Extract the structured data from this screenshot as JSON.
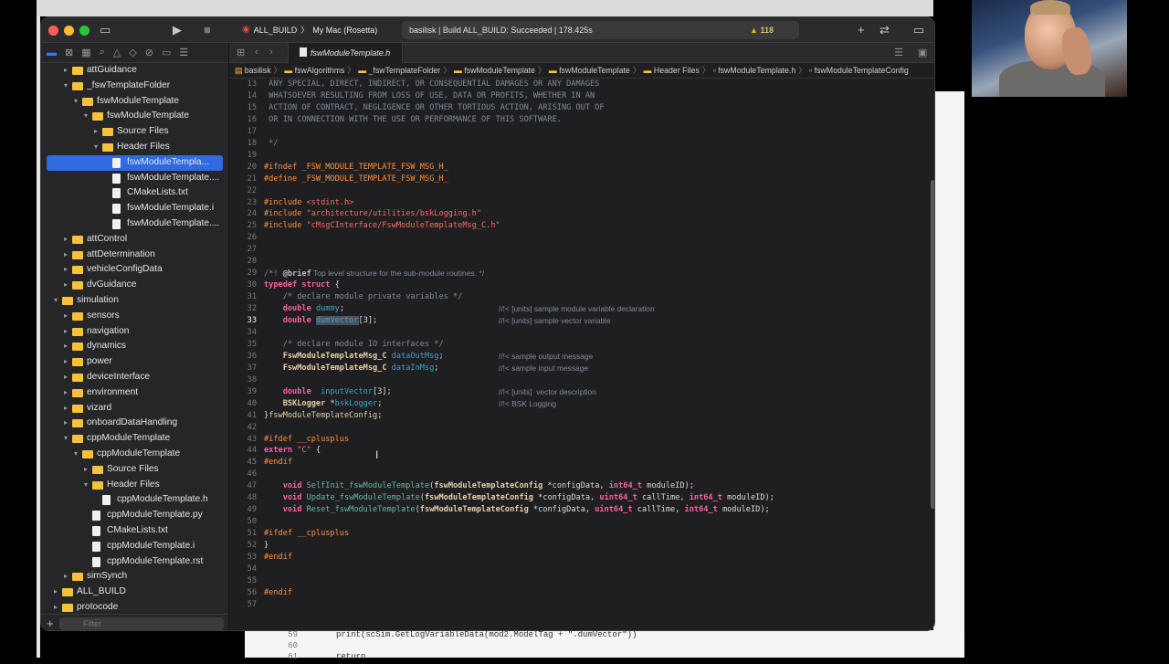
{
  "toolbar": {
    "scheme_target": "ALL_BUILD",
    "scheme_sep": "〉",
    "destination": "My Mac (Rosetta)",
    "status": "basilisk | Build ALL_BUILD: Succeeded | 178.425s",
    "warning_count": "118"
  },
  "tab": {
    "label": "fswModuleTemplate.h"
  },
  "breadcrumb": [
    "basilisk",
    "fswAlgorithms",
    "_fswTemplateFolder",
    "fswModuleTemplate",
    "fswModuleTemplate",
    "Header Files",
    "fswModuleTemplate.h",
    "fswModuleTemplateConfig"
  ],
  "sidebar": {
    "filter_placeholder": "Filter",
    "items": [
      {
        "label": "attGuidance",
        "type": "folder",
        "chev": "▸"
      },
      {
        "label": "_fswTemplateFolder",
        "type": "folder",
        "chev": "▾"
      },
      {
        "label": "fswModuleTemplate",
        "type": "folder",
        "chev": "▾"
      },
      {
        "label": "fswModuleTemplate",
        "type": "folder",
        "chev": "▾"
      },
      {
        "label": "Source Files",
        "type": "folder",
        "chev": "▸"
      },
      {
        "label": "Header Files",
        "type": "folder",
        "chev": "▾"
      },
      {
        "label": "fswModuleTempla...",
        "type": "file",
        "chev": ""
      },
      {
        "label": "fswModuleTemplate....",
        "type": "file",
        "chev": ""
      },
      {
        "label": "CMakeLists.txt",
        "type": "file",
        "chev": ""
      },
      {
        "label": "fswModuleTemplate.i",
        "type": "file",
        "chev": ""
      },
      {
        "label": "fswModuleTemplate....",
        "type": "file",
        "chev": ""
      },
      {
        "label": "attControl",
        "type": "folder",
        "chev": "▸"
      },
      {
        "label": "attDetermination",
        "type": "folder",
        "chev": "▸"
      },
      {
        "label": "vehicleConfigData",
        "type": "folder",
        "chev": "▸"
      },
      {
        "label": "dvGuidance",
        "type": "folder",
        "chev": "▸"
      },
      {
        "label": "simulation",
        "type": "folder",
        "chev": "▾"
      },
      {
        "label": "sensors",
        "type": "folder",
        "chev": "▸"
      },
      {
        "label": "navigation",
        "type": "folder",
        "chev": "▸"
      },
      {
        "label": "dynamics",
        "type": "folder",
        "chev": "▸"
      },
      {
        "label": "power",
        "type": "folder",
        "chev": "▸"
      },
      {
        "label": "deviceInterface",
        "type": "folder",
        "chev": "▸"
      },
      {
        "label": "environment",
        "type": "folder",
        "chev": "▸"
      },
      {
        "label": "vizard",
        "type": "folder",
        "chev": "▸"
      },
      {
        "label": "onboardDataHandling",
        "type": "folder",
        "chev": "▸"
      },
      {
        "label": "cppModuleTemplate",
        "type": "folder",
        "chev": "▾"
      },
      {
        "label": "cppModuleTemplate",
        "type": "folder",
        "chev": "▾"
      },
      {
        "label": "Source Files",
        "type": "folder",
        "chev": "▸"
      },
      {
        "label": "Header Files",
        "type": "folder",
        "chev": "▾"
      },
      {
        "label": "cppModuleTemplate.h",
        "type": "file",
        "chev": ""
      },
      {
        "label": "cppModuleTemplate.py",
        "type": "file",
        "chev": ""
      },
      {
        "label": "CMakeLists.txt",
        "type": "file",
        "chev": ""
      },
      {
        "label": "cppModuleTemplate.i",
        "type": "file",
        "chev": ""
      },
      {
        "label": "cppModuleTemplate.rst",
        "type": "file",
        "chev": ""
      },
      {
        "label": "simSynch",
        "type": "folder",
        "chev": "▸"
      },
      {
        "label": "ALL_BUILD",
        "type": "folder",
        "chev": "▸"
      },
      {
        "label": "protocode",
        "type": "folder",
        "chev": "▸"
      }
    ]
  },
  "code": {
    "current_line": 33,
    "lines": [
      {
        "n": "13",
        "html": "<span class=\"c-com\"> ANY SPECIAL, DIRECT, INDIRECT, OR CONSEQUENTIAL DAMAGES OR ANY DAMAGES</span>"
      },
      {
        "n": "14",
        "html": "<span class=\"c-com\"> WHATSOEVER RESULTING FROM LOSS OF USE, DATA OR PROFITS, WHETHER IN AN</span>"
      },
      {
        "n": "15",
        "html": "<span class=\"c-com\"> ACTION OF CONTRACT, NEGLIGENCE OR OTHER TORTIOUS ACTION, ARISING OUT OF</span>"
      },
      {
        "n": "16",
        "html": "<span class=\"c-com\"> OR IN CONNECTION WITH THE USE OR PERFORMANCE OF THIS SOFTWARE.</span>"
      },
      {
        "n": "17",
        "html": ""
      },
      {
        "n": "18",
        "html": "<span class=\"c-com\"> */</span>"
      },
      {
        "n": "19",
        "html": ""
      },
      {
        "n": "20",
        "html": "<span class=\"c-pp\">#ifndef _FSW_MODULE_TEMPLATE_FSW_MSG_H_</span>"
      },
      {
        "n": "21",
        "html": "<span class=\"c-pp\">#define _FSW_MODULE_TEMPLATE_FSW_MSG_H_</span>"
      },
      {
        "n": "22",
        "html": ""
      },
      {
        "n": "23",
        "html": "<span class=\"c-pp\">#include </span><span class=\"c-str\">&lt;stdint.h&gt;</span>"
      },
      {
        "n": "24",
        "html": "<span class=\"c-pp\">#include </span><span class=\"c-str\">\"architecture/utilities/bskLogging.h\"</span>"
      },
      {
        "n": "25",
        "html": "<span class=\"c-pp\">#include </span><span class=\"c-str\">\"cMsgCInterface/FswModuleTemplateMsg_C.h\"</span>"
      },
      {
        "n": "26",
        "html": ""
      },
      {
        "n": "27",
        "html": ""
      },
      {
        "n": "28",
        "html": ""
      },
      {
        "n": "29",
        "html": "<span class=\"c-com\">/*! </span><span style=\"color:#bdbdbd;font-weight:bold\">@brief</span><span class=\"c-com\" style=\"font-family:'Liberation Sans',sans-serif\"> Top level structure for the sub-module routines. */</span>"
      },
      {
        "n": "30",
        "html": "<span class=\"c-kw\">typedef struct</span> {"
      },
      {
        "n": "31",
        "html": "    <span class=\"c-com\">/* declare module private variables */</span>"
      },
      {
        "n": "32",
        "html": "    <span class=\"c-kw\">double</span> <span class=\"c-id\">dummy</span>;",
        "cm": "//!< [units] sample module variable declaration"
      },
      {
        "n": "33",
        "html": "    <span class=\"c-kw\">double</span> <span class=\"c-id hl\">dumVector</span>[3];",
        "cm": "//!< [units] sample vector variable"
      },
      {
        "n": "34",
        "html": ""
      },
      {
        "n": "35",
        "html": "    <span class=\"c-com\">/* declare module IO interfaces */</span>"
      },
      {
        "n": "36",
        "html": "    <span class=\"c-typ\" style=\"color:#e5cfa8;font-weight:bold\">FswModuleTemplateMsg_C</span> <span class=\"c-id\">dataOutMsg</span>;",
        "cm": "//!< sample output message"
      },
      {
        "n": "37",
        "html": "    <span class=\"c-typ\" style=\"color:#e5cfa8;font-weight:bold\">FswModuleTemplateMsg_C</span> <span class=\"c-id\">dataInMsg</span>;",
        "cm": "//!< sample input message"
      },
      {
        "n": "38",
        "html": ""
      },
      {
        "n": "39",
        "html": "    <span class=\"c-kw\">double</span>  <span class=\"c-id\">inputVector</span>[3];",
        "cm": "//!< [units]  vector description"
      },
      {
        "n": "40",
        "html": "    <span style=\"color:#e5cfa8;font-weight:bold\">BSKLogger</span> *<span class=\"c-id\">bskLogger</span>;",
        "cm": "//!< BSK Logging"
      },
      {
        "n": "41",
        "html": "}<span style=\"color:#e5cfa8\">fswModuleTemplateConfig</span>;"
      },
      {
        "n": "42",
        "html": ""
      },
      {
        "n": "43",
        "html": "<span class=\"c-pp\">#ifdef __cplusplus</span>"
      },
      {
        "n": "44",
        "html": "<span class=\"c-kw\">extern</span> <span class=\"c-str\">\"C\"</span> {"
      },
      {
        "n": "45",
        "html": "<span class=\"c-pp\">#endif</span>"
      },
      {
        "n": "46",
        "html": ""
      },
      {
        "n": "47",
        "html": "    <span class=\"c-kw\">void</span> <span class=\"c-fn\">SelfInit_fswModuleTemplate</span>(<span style=\"color:#e5cfa8;font-weight:bold\">fswModuleTemplateConfig</span> *configData, <span class=\"c-kw\">int64_t</span> moduleID);"
      },
      {
        "n": "48",
        "html": "    <span class=\"c-kw\">void</span> <span class=\"c-fn\">Update_fswModuleTemplate</span>(<span style=\"color:#e5cfa8;font-weight:bold\">fswModuleTemplateConfig</span> *configData, <span class=\"c-kw\">uint64_t</span> callTime, <span class=\"c-kw\">int64_t</span> moduleID);"
      },
      {
        "n": "49",
        "html": "    <span class=\"c-kw\">void</span> <span class=\"c-fn\">Reset_fswModuleTemplate</span>(<span style=\"color:#e5cfa8;font-weight:bold\">fswModuleTemplateConfig</span> *configData, <span class=\"c-kw\">uint64_t</span> callTime, <span class=\"c-kw\">int64_t</span> moduleID);"
      },
      {
        "n": "50",
        "html": ""
      },
      {
        "n": "51",
        "html": "<span class=\"c-pp\">#ifdef __cplusplus</span>"
      },
      {
        "n": "52",
        "html": "}"
      },
      {
        "n": "53",
        "html": "<span class=\"c-pp\">#endif</span>"
      },
      {
        "n": "54",
        "html": ""
      },
      {
        "n": "55",
        "html": ""
      },
      {
        "n": "56",
        "html": "<span class=\"c-pp\">#endif</span>"
      },
      {
        "n": "57",
        "html": ""
      }
    ]
  },
  "background_editor": {
    "lines": [
      {
        "n": "59",
        "t": "print(scSim.GetLogVariableData(mod2.ModelTag + \".dumVector\"))"
      },
      {
        "n": "60",
        "t": ""
      },
      {
        "n": "61",
        "t": "return"
      }
    ]
  },
  "colors": {
    "accent": "#2f6ae0",
    "folder": "#f7c13e",
    "keyword": "#fc5fa3",
    "preprocessor": "#fd8f3f"
  }
}
